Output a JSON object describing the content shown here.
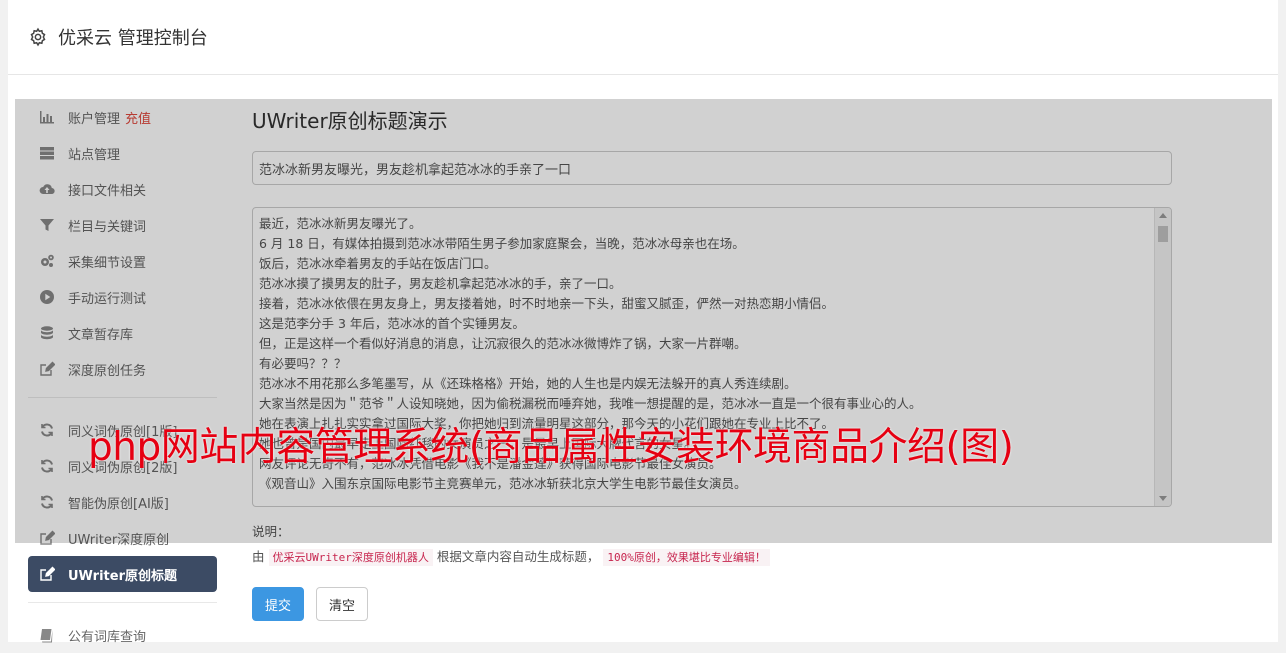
{
  "header": {
    "title": "优采云 管理控制台",
    "icon": "gear-icon"
  },
  "sidebar": {
    "group1": [
      {
        "label": "账户管理",
        "extra": "充值",
        "icon": "bar-chart-icon"
      },
      {
        "label": "站点管理",
        "icon": "server-icon"
      },
      {
        "label": "接口文件相关",
        "icon": "cloud-upload-icon"
      },
      {
        "label": "栏目与关键词",
        "icon": "filter-icon"
      },
      {
        "label": "采集细节设置",
        "icon": "cogs-icon"
      },
      {
        "label": "手动运行测试",
        "icon": "play-circle-icon"
      },
      {
        "label": "文章暂存库",
        "icon": "database-icon"
      },
      {
        "label": "深度原创任务",
        "icon": "edit-icon"
      }
    ],
    "group2": [
      {
        "label": "同义词伪原创[1版]",
        "icon": "refresh-icon"
      },
      {
        "label": "同义词伪原创[2版]",
        "icon": "refresh-icon"
      },
      {
        "label": "智能伪原创[AI版]",
        "icon": "refresh-icon"
      },
      {
        "label": "UWriter深度原创",
        "icon": "edit-icon"
      },
      {
        "label": "UWriter原创标题",
        "icon": "edit-icon",
        "active": true
      }
    ],
    "group3": [
      {
        "label": "公有词库查询",
        "icon": "book-icon"
      }
    ]
  },
  "main": {
    "page_title": "UWriter原创标题演示",
    "title_value": "范冰冰新男友曝光，男友趁机拿起范冰冰的手亲了一口",
    "article_lines": [
      "最近，范冰冰新男友曝光了。",
      "6 月 18 日，有媒体拍摄到范冰冰带陌生男子参加家庭聚会，当晚，范冰冰母亲也在场。",
      "饭后，范冰冰牵着男友的手站在饭店门口。",
      "范冰冰摸了摸男友的肚子，男友趁机拿起范冰冰的手，亲了一口。",
      "接着，范冰冰依偎在男友身上，男友搂着她，时不时地亲一下头，甜蜜又腻歪，俨然一对热恋期小情侣。",
      "这是范李分手 3 年后，范冰冰的首个实锤男友。",
      "但，正是这样一个看似好消息的消息，让沉寂很久的范冰冰微博炸了锅，大家一片群嘲。",
      "有必要吗？？？",
      "范冰冰不用花那么多笔墨写，从《还珠格格》开始，她的人生也是内娱无法躲开的真人秀连续剧。",
      "大家当然是因为＂范爷＂人设知晓她，因为偷税漏税而唾弃她，我唯一想提醒的是，范冰冰一直是一个很有事业心的人。",
      "她在表演上扎扎实实拿过国际大奖，你把她归到流量明星这部分，那今天的小花们跟她在专业上比不了。",
      "她也曾是国内最早走上国际红毯的女演员之一，是最早上国际大牌代言的女星。",
      "网友评论无奇不有，范冰冰凭借电影《我不是潘金莲》获得国际电影节最佳女演员。",
      "《观音山》入围东京国际电影节主竞赛单元，范冰冰斩获北京大学生电影节最佳女演员。"
    ],
    "note_label": "说明：",
    "note_prefix": "由",
    "note_code1": "优采云UWriter深度原创机器人",
    "note_middle": "根据文章内容自动生成标题，",
    "note_code2": "100%原创，效果堪比专业编辑！",
    "submit_label": "提交",
    "clear_label": "清空"
  },
  "watermark": "php网站内容管理系统(商品属性安装环境商品介绍(图)"
}
